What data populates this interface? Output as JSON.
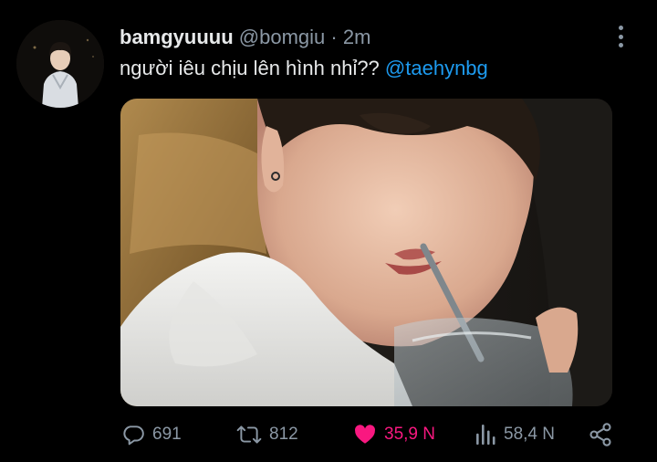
{
  "tweet": {
    "display_name": "bamgyuuuu",
    "handle": "@bomgiu",
    "separator": "·",
    "time": "2m",
    "text": "người iêu chịu lên hình nhỉ??",
    "mention": "@taehynbg"
  },
  "actions": {
    "replies": "691",
    "retweets": "812",
    "likes": "35,9 N",
    "views": "58,4 N",
    "liked": true
  },
  "icons": {
    "avatar": "profile-photo",
    "more": "more-vertical-icon",
    "reply": "reply-icon",
    "retweet": "retweet-icon",
    "like": "heart-filled-icon",
    "views": "views-bar-icon",
    "share": "share-icon"
  },
  "colors": {
    "background": "#000000",
    "text": "#e7e9ea",
    "muted": "#8b98a5",
    "mention": "#1d9bf0",
    "like": "#f91880"
  }
}
